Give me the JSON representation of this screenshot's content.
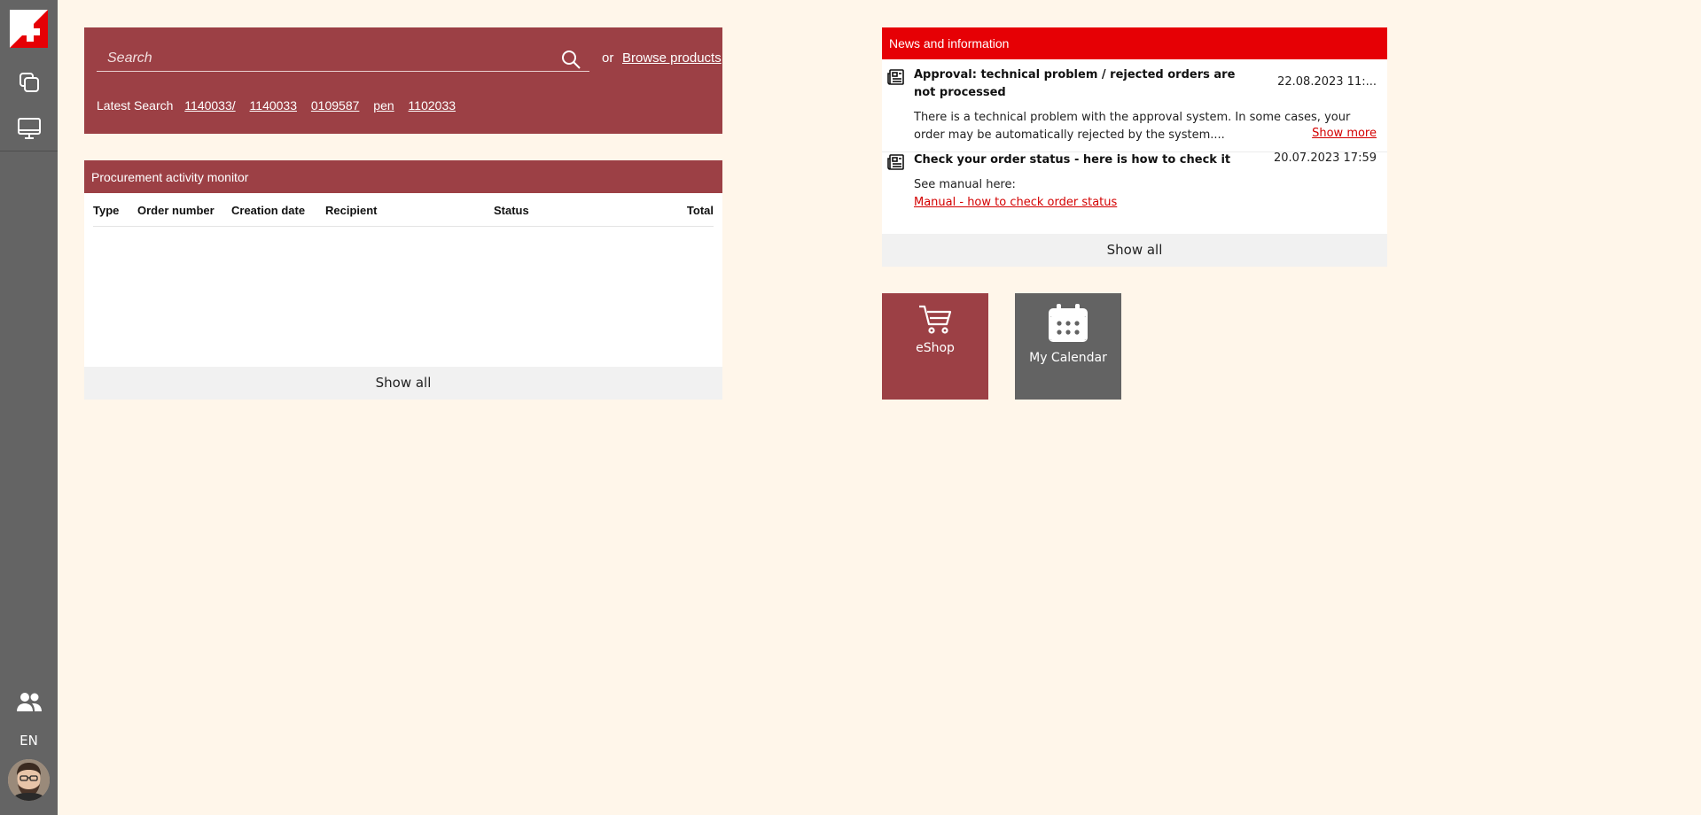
{
  "sidebar": {
    "language": "EN"
  },
  "search": {
    "placeholder": "Search",
    "or_text": "or",
    "browse_label": "Browse products",
    "latest_label": "Latest Search",
    "latest_items": [
      "1140033/",
      "1140033",
      "0109587",
      "pen",
      "1102033"
    ]
  },
  "procurement": {
    "title": "Procurement activity monitor",
    "columns": [
      "Type",
      "Order number",
      "Creation date",
      "Recipient",
      "Status",
      "Total"
    ],
    "show_all": "Show all"
  },
  "news": {
    "title": "News and information",
    "items": [
      {
        "title": "Approval: technical problem / rejected orders are not processed",
        "date": "22.08.2023 11:...",
        "body": "There is a technical problem with the approval system. In some cases, your order may be automatically rejected by the system....",
        "more": "Show more"
      },
      {
        "title": "Check your order status - here is how to check it",
        "date": "20.07.2023 17:59",
        "body": "See manual here:",
        "link": "Manual - how to check order status"
      }
    ],
    "show_all": "Show all"
  },
  "tiles": {
    "eshop": "eShop",
    "calendar": "My Calendar"
  },
  "colors": {
    "brand_dark_red": "#9c4045",
    "news_red": "#e60005",
    "sidebar_gray": "#646464",
    "background": "#fff6ea"
  }
}
